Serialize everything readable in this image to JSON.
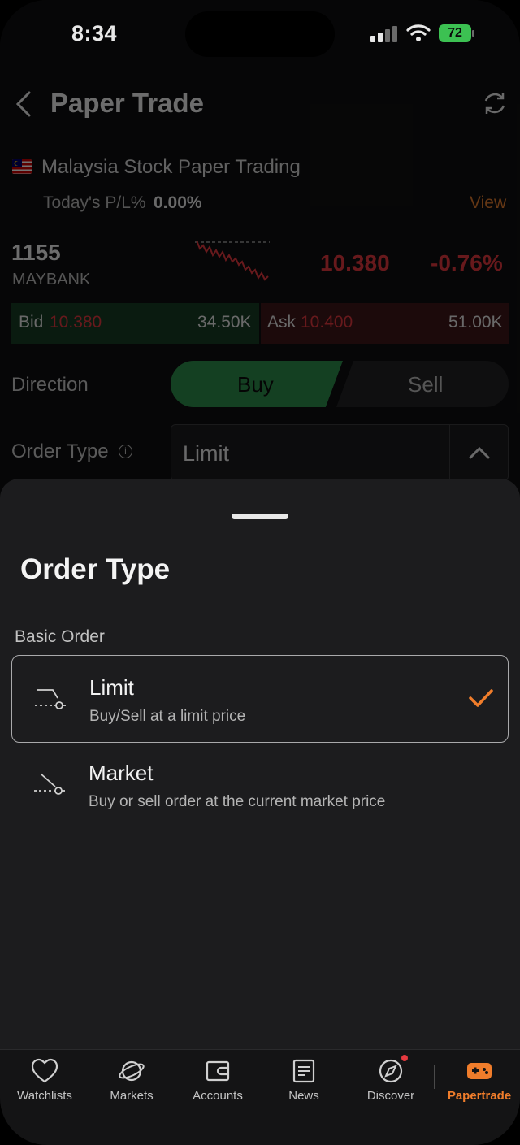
{
  "status_bar": {
    "time": "8:34",
    "battery": "72"
  },
  "header": {
    "title": "Paper Trade",
    "back_icon": "chevron-left-icon",
    "refresh_icon": "refresh-icon"
  },
  "account": {
    "market_name": "Malaysia Stock Paper Trading",
    "pl_label": "Today's P/L%",
    "pl_value": "0.00%",
    "view_label": "View"
  },
  "stock": {
    "code": "1155",
    "name": "MAYBANK",
    "price": "10.380",
    "change": "-0.76%"
  },
  "quote": {
    "bid_label": "Bid",
    "bid_price": "10.380",
    "bid_volume": "34.50K",
    "ask_label": "Ask",
    "ask_price": "10.400",
    "ask_volume": "51.00K"
  },
  "form": {
    "direction_label": "Direction",
    "buy_label": "Buy",
    "sell_label": "Sell",
    "order_type_label": "Order Type",
    "order_type_value": "Limit"
  },
  "sheet": {
    "title": "Order Type",
    "section_label": "Basic Order",
    "options": [
      {
        "title": "Limit",
        "description": "Buy/Sell at a limit price",
        "selected": true
      },
      {
        "title": "Market",
        "description": "Buy or sell order at the current market price",
        "selected": false
      }
    ]
  },
  "tabbar": {
    "items": [
      {
        "label": "Watchlists",
        "icon": "heart-icon"
      },
      {
        "label": "Markets",
        "icon": "planet-icon"
      },
      {
        "label": "Accounts",
        "icon": "wallet-icon"
      },
      {
        "label": "News",
        "icon": "news-icon"
      },
      {
        "label": "Discover",
        "icon": "compass-icon"
      },
      {
        "label": "Papertrade",
        "icon": "gamepad-icon",
        "active": true
      }
    ]
  },
  "colors": {
    "accent": "#f07d2b",
    "down": "#e5393f",
    "buy": "#2e8f4d"
  }
}
